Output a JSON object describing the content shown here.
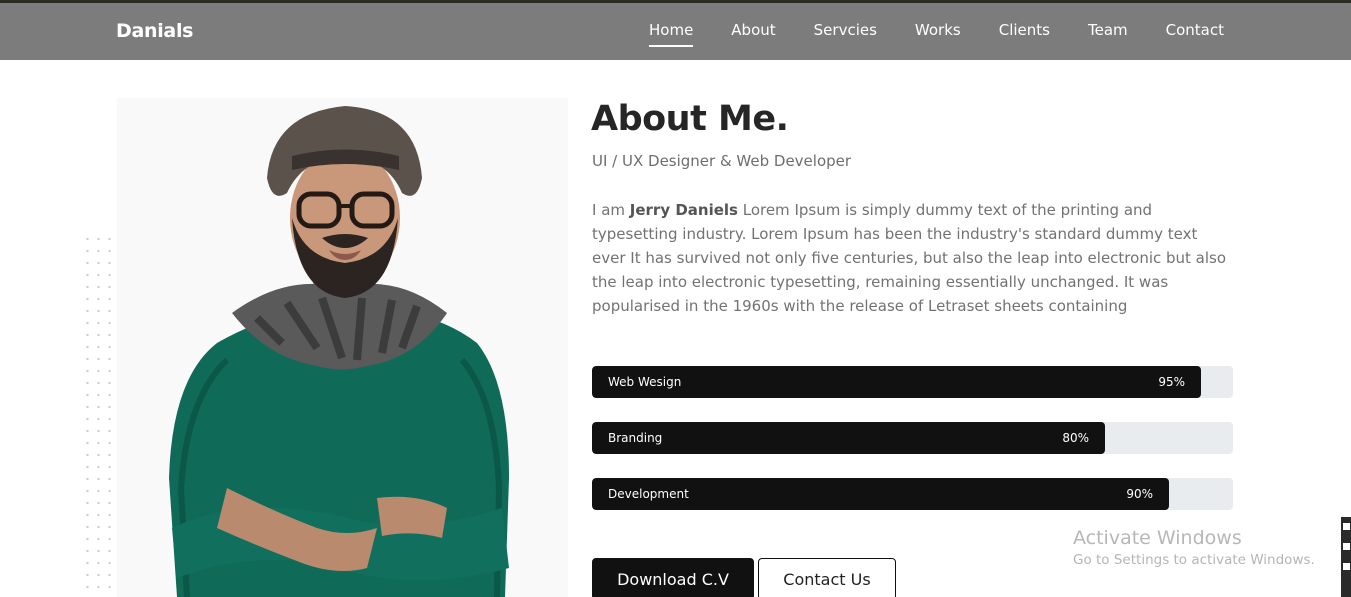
{
  "brand": "Danials",
  "nav": [
    {
      "label": "Home",
      "active": true
    },
    {
      "label": "About",
      "active": false
    },
    {
      "label": "Servcies",
      "active": false
    },
    {
      "label": "Works",
      "active": false
    },
    {
      "label": "Clients",
      "active": false
    },
    {
      "label": "Team",
      "active": false
    },
    {
      "label": "Contact",
      "active": false
    }
  ],
  "about": {
    "title": "About Me.",
    "subtitle": "UI / UX Designer & Web Developer",
    "bio_prefix": "I am ",
    "bio_name": "Jerry Daniels",
    "bio_text": " Lorem Ipsum is simply dummy text of the printing and typesetting industry. Lorem Ipsum has been the industry's standard dummy text ever It has survived not only five centuries, but also the leap into electronic but also the leap into electronic typesetting, remaining essentially unchanged. It was popularised in the 1960s with the release of Letraset sheets containing"
  },
  "skills": [
    {
      "name": "Web Wesign",
      "percent_label": "95%",
      "percent": 95
    },
    {
      "name": "Branding",
      "percent_label": "80%",
      "percent": 80
    },
    {
      "name": "Development",
      "percent_label": "90%",
      "percent": 90
    }
  ],
  "buttons": {
    "download": "Download C.V",
    "contact": "Contact Us"
  },
  "watermark": {
    "title": "Activate Windows",
    "subtitle": "Go to Settings to activate Windows."
  },
  "colors": {
    "navbar": "#7c7c7c",
    "skill_fill": "#111111",
    "skill_track": "#e9ecef",
    "sweater": "#0f6a58"
  },
  "photo": {
    "icon": "portrait-man-hat-glasses-scarf"
  }
}
